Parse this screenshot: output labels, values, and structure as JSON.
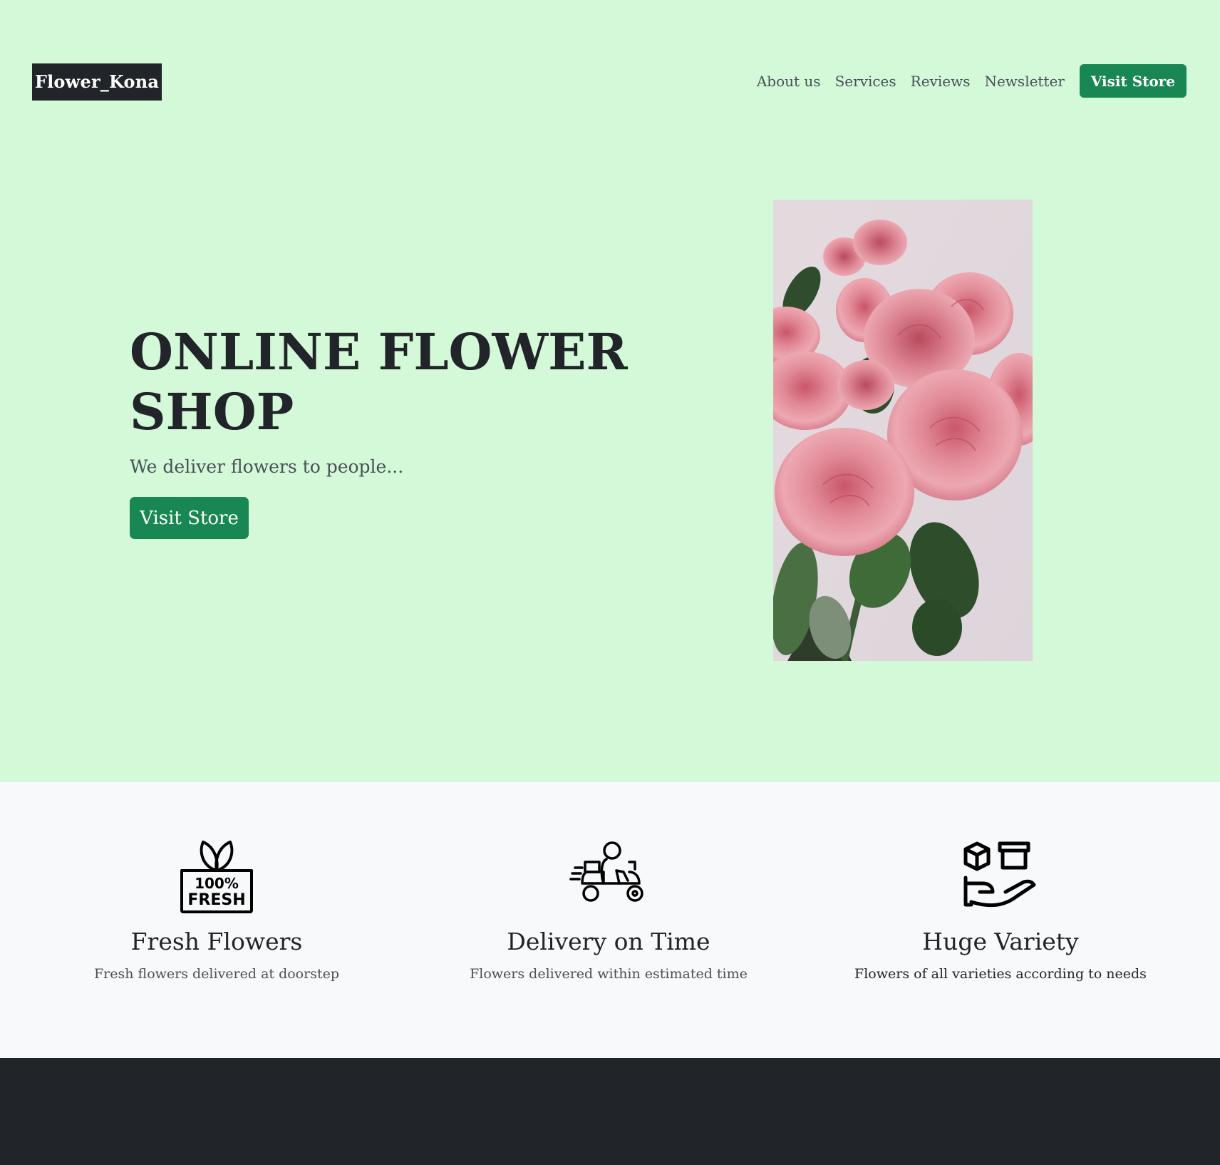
{
  "brand": {
    "logo_text": "Flower_Kona"
  },
  "nav": {
    "links": [
      "About us",
      "Services",
      "Reviews",
      "Newsletter"
    ],
    "cta_label": "Visit Store"
  },
  "hero": {
    "title": "ONLINE FLOWER SHOP",
    "subtitle": "We deliver flowers to people...",
    "cta_label": "Visit Store",
    "image": "pink-roses-photo"
  },
  "features": [
    {
      "icon": "fresh-100-percent-icon",
      "title": "Fresh Flowers",
      "description": "Fresh flowers delivered at doorstep"
    },
    {
      "icon": "delivery-scooter-icon",
      "title": "Delivery on Time",
      "description": "Flowers delivered within estimated time"
    },
    {
      "icon": "hand-boxes-icon",
      "title": "Huge Variety",
      "description": "Flowers of all varieties according to needs"
    }
  ],
  "colors": {
    "hero_bg": "#d3f9d8",
    "accent": "#198754",
    "dark": "#212529",
    "features_bg": "#f8f9fa",
    "muted_text": "#495057"
  }
}
